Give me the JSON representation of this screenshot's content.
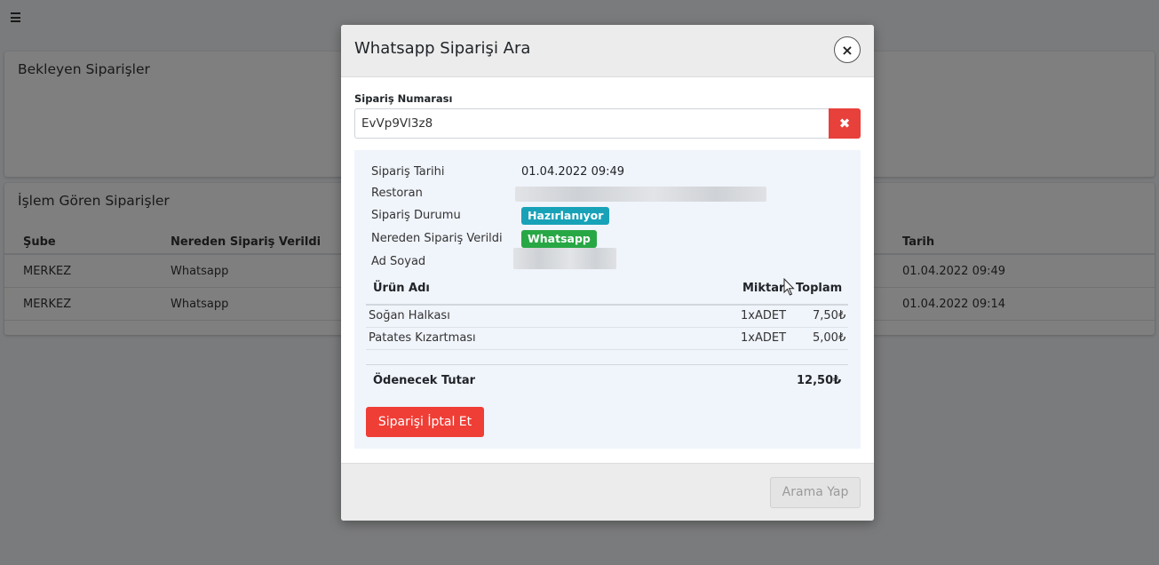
{
  "background": {
    "pending_card": {
      "title": "Bekleyen Siparişler"
    },
    "processing_card": {
      "title": "İşlem Gören Siparişler",
      "columns": [
        "Şube",
        "Nereden Sipariş Verildi",
        "Tarih"
      ],
      "rows": [
        [
          "MERKEZ",
          "Whatsapp",
          "01.04.2022 09:49"
        ],
        [
          "MERKEZ",
          "Whatsapp",
          "01.04.2022 09:14"
        ]
      ]
    }
  },
  "modal": {
    "title": "Whatsapp Siparişi Ara",
    "close_icon": "×",
    "search": {
      "label": "Sipariş Numarası",
      "value": "EvVp9Vl3z8",
      "clear_icon": "✖"
    },
    "details": {
      "date_label": "Sipariş Tarihi",
      "date_value": "01.04.2022 09:49",
      "restaurant_label": "Restoran",
      "status_label": "Sipariş Durumu",
      "status_value": "Hazırlanıyor",
      "source_label": "Nereden Sipariş Verildi",
      "source_value": "Whatsapp",
      "name_label": "Ad Soyad"
    },
    "items": {
      "columns": [
        "Ürün Adı",
        "Miktar",
        "Toplam"
      ],
      "rows": [
        [
          "Soğan Halkası",
          "1xADET",
          "7,50₺"
        ],
        [
          "Patates Kızartması",
          "1xADET",
          "5,00₺"
        ]
      ],
      "total_label": "Ödenecek Tutar",
      "total_value": "12,50₺"
    },
    "cancel_button": "Siparişi İptal Et",
    "search_button": "Arama Yap"
  },
  "colors": {
    "danger": "#ef3e36",
    "info": "#17a2b8",
    "success": "#28a745"
  },
  "icons": [
    "menu-icon",
    "close-icon",
    "clear-icon",
    "mouse-cursor-icon"
  ]
}
